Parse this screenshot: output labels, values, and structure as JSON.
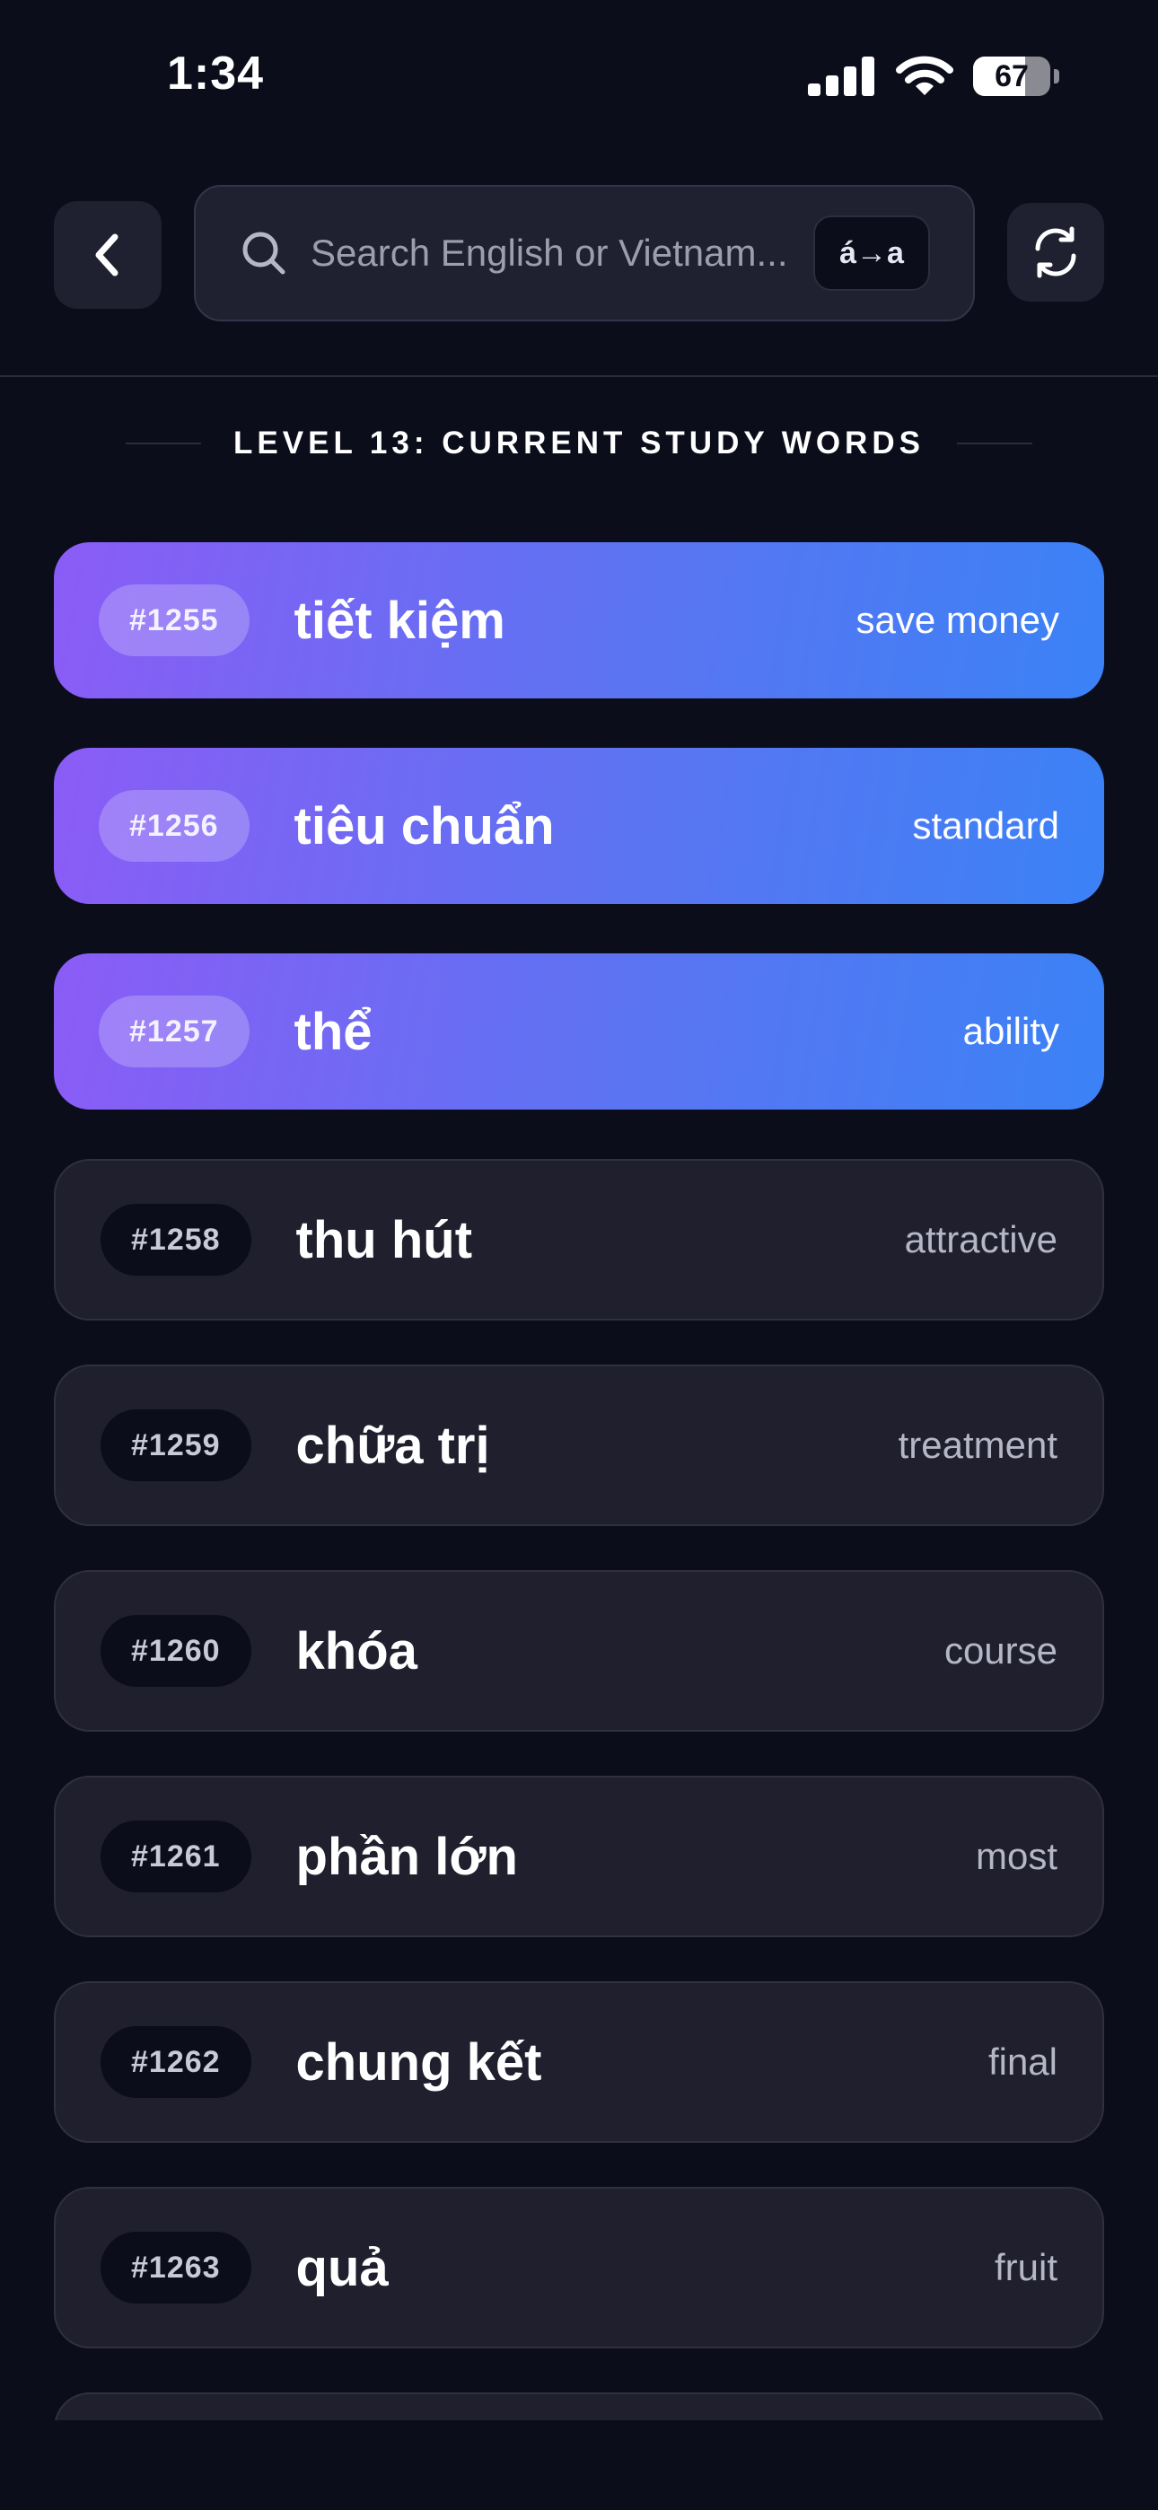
{
  "status_bar": {
    "time": "1:34",
    "battery": "67",
    "battery_level": 0.67
  },
  "header": {
    "search_placeholder": "Search English or Vietnam...",
    "diacritic_toggle_label": "á→a"
  },
  "section": {
    "title": "LEVEL 13: CURRENT STUDY WORDS"
  },
  "words": [
    {
      "number": "#1255",
      "vietnamese": "tiết kiệm",
      "english": "save money",
      "active": true
    },
    {
      "number": "#1256",
      "vietnamese": "tiêu chuẩn",
      "english": "standard",
      "active": true
    },
    {
      "number": "#1257",
      "vietnamese": "thể",
      "english": "ability",
      "active": true
    },
    {
      "number": "#1258",
      "vietnamese": "thu hút",
      "english": "attractive",
      "active": false
    },
    {
      "number": "#1259",
      "vietnamese": "chữa trị",
      "english": "treatment",
      "active": false
    },
    {
      "number": "#1260",
      "vietnamese": "khóa",
      "english": "course",
      "active": false
    },
    {
      "number": "#1261",
      "vietnamese": "phần lớn",
      "english": "most",
      "active": false
    },
    {
      "number": "#1262",
      "vietnamese": "chung kết",
      "english": "final",
      "active": false
    },
    {
      "number": "#1263",
      "vietnamese": "quả",
      "english": "fruit",
      "active": false
    }
  ],
  "colors": {
    "background": "#0b0d1b",
    "card": "#1f1f2e",
    "gradient_start": "#8b5cf6",
    "gradient_end": "#3b82f6"
  }
}
